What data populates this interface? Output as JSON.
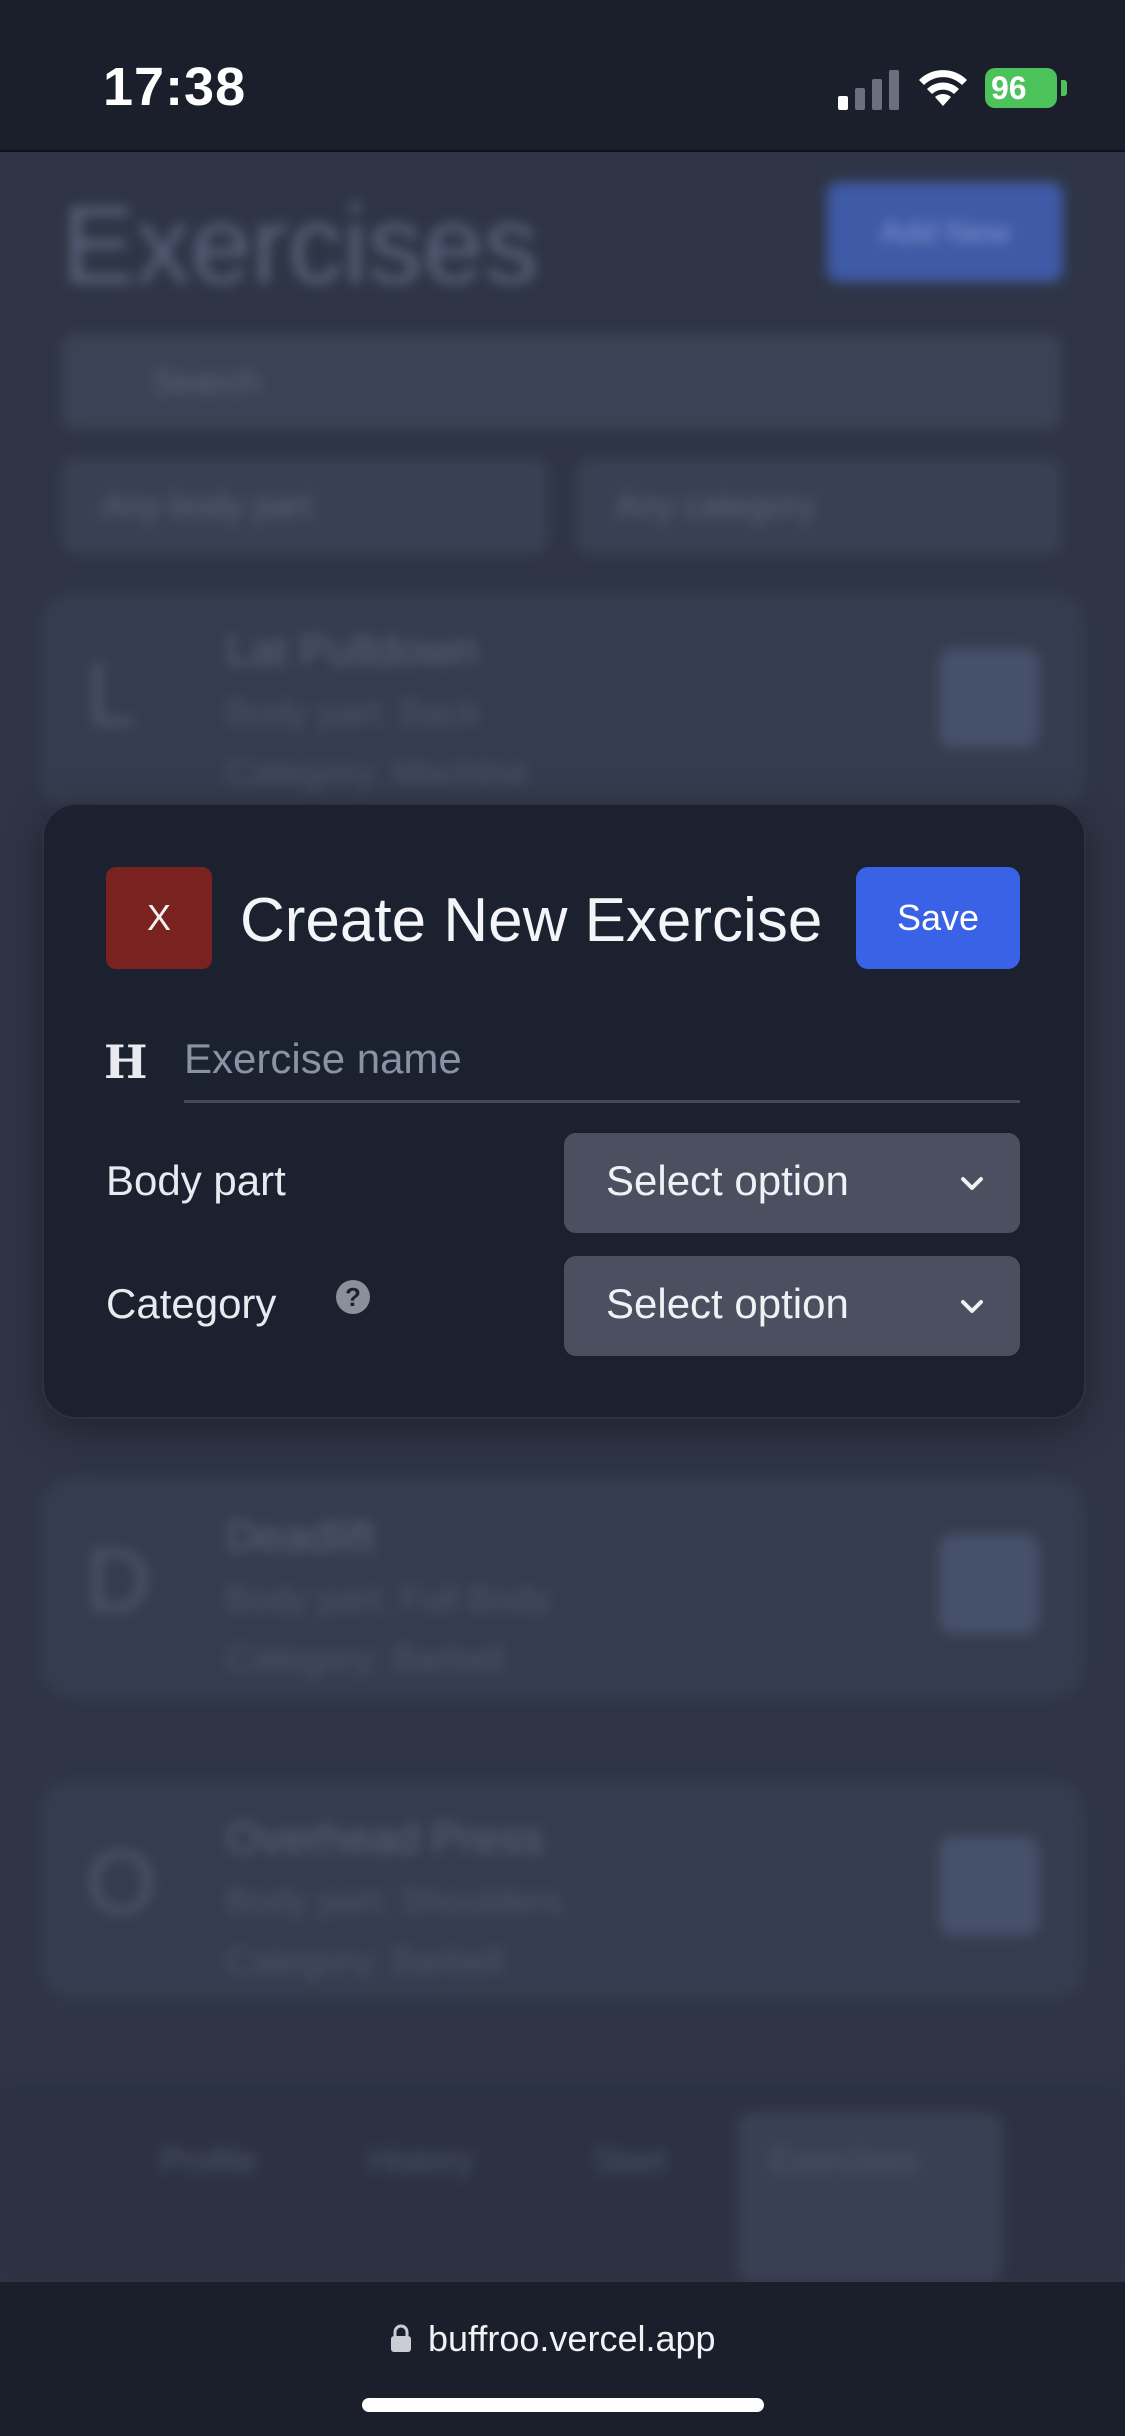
{
  "status_bar": {
    "time": "17:38",
    "battery": "96"
  },
  "background": {
    "title": "Exercises",
    "add_button": "Add New",
    "search_placeholder": "Search",
    "filter_body": "Any body part",
    "filter_category": "Any category",
    "cards": [
      {
        "letter": "L",
        "name": "Lat Pulldown",
        "body": "Body part: Back",
        "category": "Category: Machine"
      },
      {
        "letter": "D",
        "name": "Deadlift",
        "body": "Body part: Full Body",
        "category": "Category: Barbell"
      },
      {
        "letter": "O",
        "name": "Overhead Press",
        "body": "Body part: Shoulders",
        "category": "Category: Barbell"
      }
    ],
    "nav": [
      "Profile",
      "History",
      "Start",
      "Exercises"
    ]
  },
  "modal": {
    "close_label": "X",
    "title": "Create New Exercise",
    "save_label": "Save",
    "name_placeholder": "Exercise name",
    "body_part_label": "Body part",
    "body_part_value": "Select option",
    "category_label": "Category",
    "category_value": "Select option",
    "help_glyph": "?"
  },
  "url_bar": {
    "url": "buffroo.vercel.app"
  }
}
